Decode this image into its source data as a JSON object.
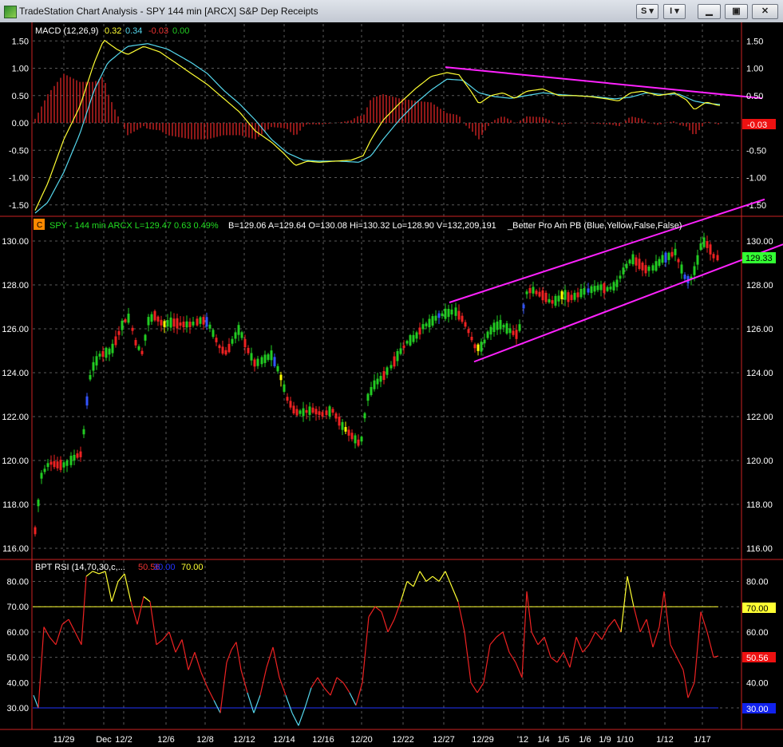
{
  "window": {
    "title": "TradeStation Chart Analysis - SPY 144 min [ARCX] S&P Dep Receipts",
    "buttons": {
      "style": "S",
      "indicators": "I"
    }
  },
  "colors": {
    "background": "#000000",
    "grid": "#5a5a5a",
    "axis_text": "#ffffff",
    "up_bar": "#22cc22",
    "down_bar": "#ee2222",
    "blue_bar": "#3355ff",
    "yellow_bar": "#ffff00",
    "macd_line": "#ffff33",
    "signal_line": "#55d8ee",
    "trendline": "#ff22ff",
    "separator": "#cc2222"
  },
  "macd": {
    "header": "MACD (12,26,9)",
    "macd_value": "0.32",
    "signal_value": "0.34",
    "diff_value": "-0.03",
    "zero_value": "0.00",
    "axis_labels": [
      "1.50",
      "1.00",
      "0.50",
      "0.00",
      "-0.50",
      "-1.00",
      "-1.50"
    ],
    "last_tag": "-0.03"
  },
  "price": {
    "badge": "C",
    "symbol_info": "SPY - 144 min  ARCX  L=129.47  0.63  0.49%",
    "quote_info": "B=129.06  A=129.64  O=130.08  Hi=130.32  Lo=128.90  V=132,209,191",
    "indicator_name": "_Better Pro Am PB (Blue,Yellow,False,False)",
    "axis_labels": [
      "130.00",
      "128.00",
      "126.00",
      "124.00",
      "122.00",
      "120.00",
      "118.00",
      "116.00"
    ],
    "last_tag": "129.33"
  },
  "rsi": {
    "header": "BPT RSI (14,70,30,c,...",
    "rsi_value": "50.56",
    "low_value": "30.00",
    "high_value": "70.00",
    "axis_labels": [
      "80.00",
      "70.00",
      "60.00",
      "50.00",
      "40.00",
      "30.00"
    ],
    "tag_70": "70.00",
    "tag_val": "50.56",
    "tag_30": "30.00"
  },
  "date_axis": [
    "11/29",
    "Dec",
    "12/2",
    "12/6",
    "12/8",
    "12/12",
    "12/14",
    "12/16",
    "12/20",
    "12/22",
    "12/27",
    "12/29",
    "'12",
    "1/4",
    "1/5",
    "1/6",
    "1/9",
    "1/10",
    "1/12",
    "1/17"
  ],
  "chart_data": {
    "type": "candlestick",
    "symbol": "SPY",
    "interval": "144 min",
    "price_ylim": [
      115.5,
      131
    ],
    "macd_ylim": [
      -1.7,
      1.65
    ],
    "rsi_ylim": [
      22,
      86
    ],
    "rsi_levels": [
      70,
      30
    ],
    "trend_channel": {
      "upper": [
        [
          "12/27",
          127.2
        ],
        [
          "1/17",
          131.6
        ]
      ],
      "lower": [
        [
          "12/29",
          124.5
        ],
        [
          "1/17",
          129.4
        ]
      ]
    },
    "macd_trendline": [
      [
        "12/27",
        1.02
      ],
      [
        "1/17",
        0.5
      ]
    ]
  }
}
